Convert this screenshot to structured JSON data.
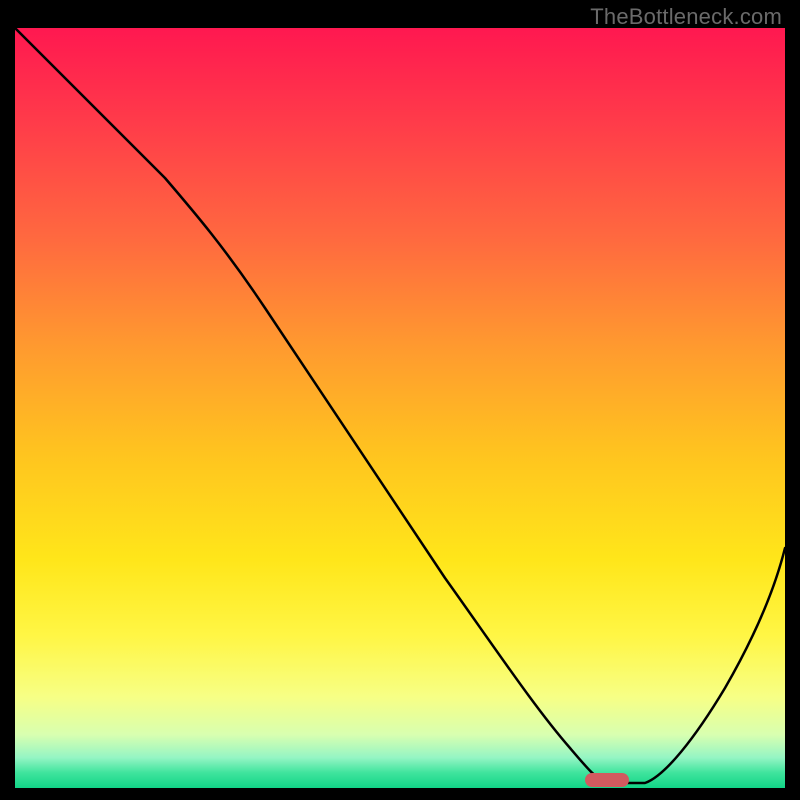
{
  "watermark": "TheBottleneck.com",
  "chart_data": {
    "type": "line",
    "title": "",
    "xlabel": "",
    "ylabel": "",
    "xlim": [
      0,
      100
    ],
    "ylim": [
      0,
      100
    ],
    "series": [
      {
        "name": "bottleneck-curve",
        "x": [
          0,
          8,
          16,
          24,
          32,
          40,
          48,
          56,
          64,
          70,
          74,
          78,
          82,
          88,
          94,
          100
        ],
        "y": [
          100,
          92,
          84,
          76,
          64,
          52,
          40,
          28,
          16,
          6,
          1,
          0,
          0,
          8,
          20,
          34
        ]
      }
    ],
    "marker": {
      "x": 77,
      "y": 0,
      "color": "#d25a5f"
    },
    "gradient_stops": [
      {
        "pos": 0,
        "color": "#ff1850"
      },
      {
        "pos": 12,
        "color": "#ff3a4a"
      },
      {
        "pos": 28,
        "color": "#ff6a3f"
      },
      {
        "pos": 42,
        "color": "#ff9a2f"
      },
      {
        "pos": 56,
        "color": "#ffc41f"
      },
      {
        "pos": 70,
        "color": "#ffe61a"
      },
      {
        "pos": 80,
        "color": "#fff645"
      },
      {
        "pos": 88,
        "color": "#f7ff85"
      },
      {
        "pos": 93,
        "color": "#d8ffb0"
      },
      {
        "pos": 96,
        "color": "#95f5c4"
      },
      {
        "pos": 98,
        "color": "#3fe49d"
      },
      {
        "pos": 100,
        "color": "#11d487"
      }
    ]
  }
}
